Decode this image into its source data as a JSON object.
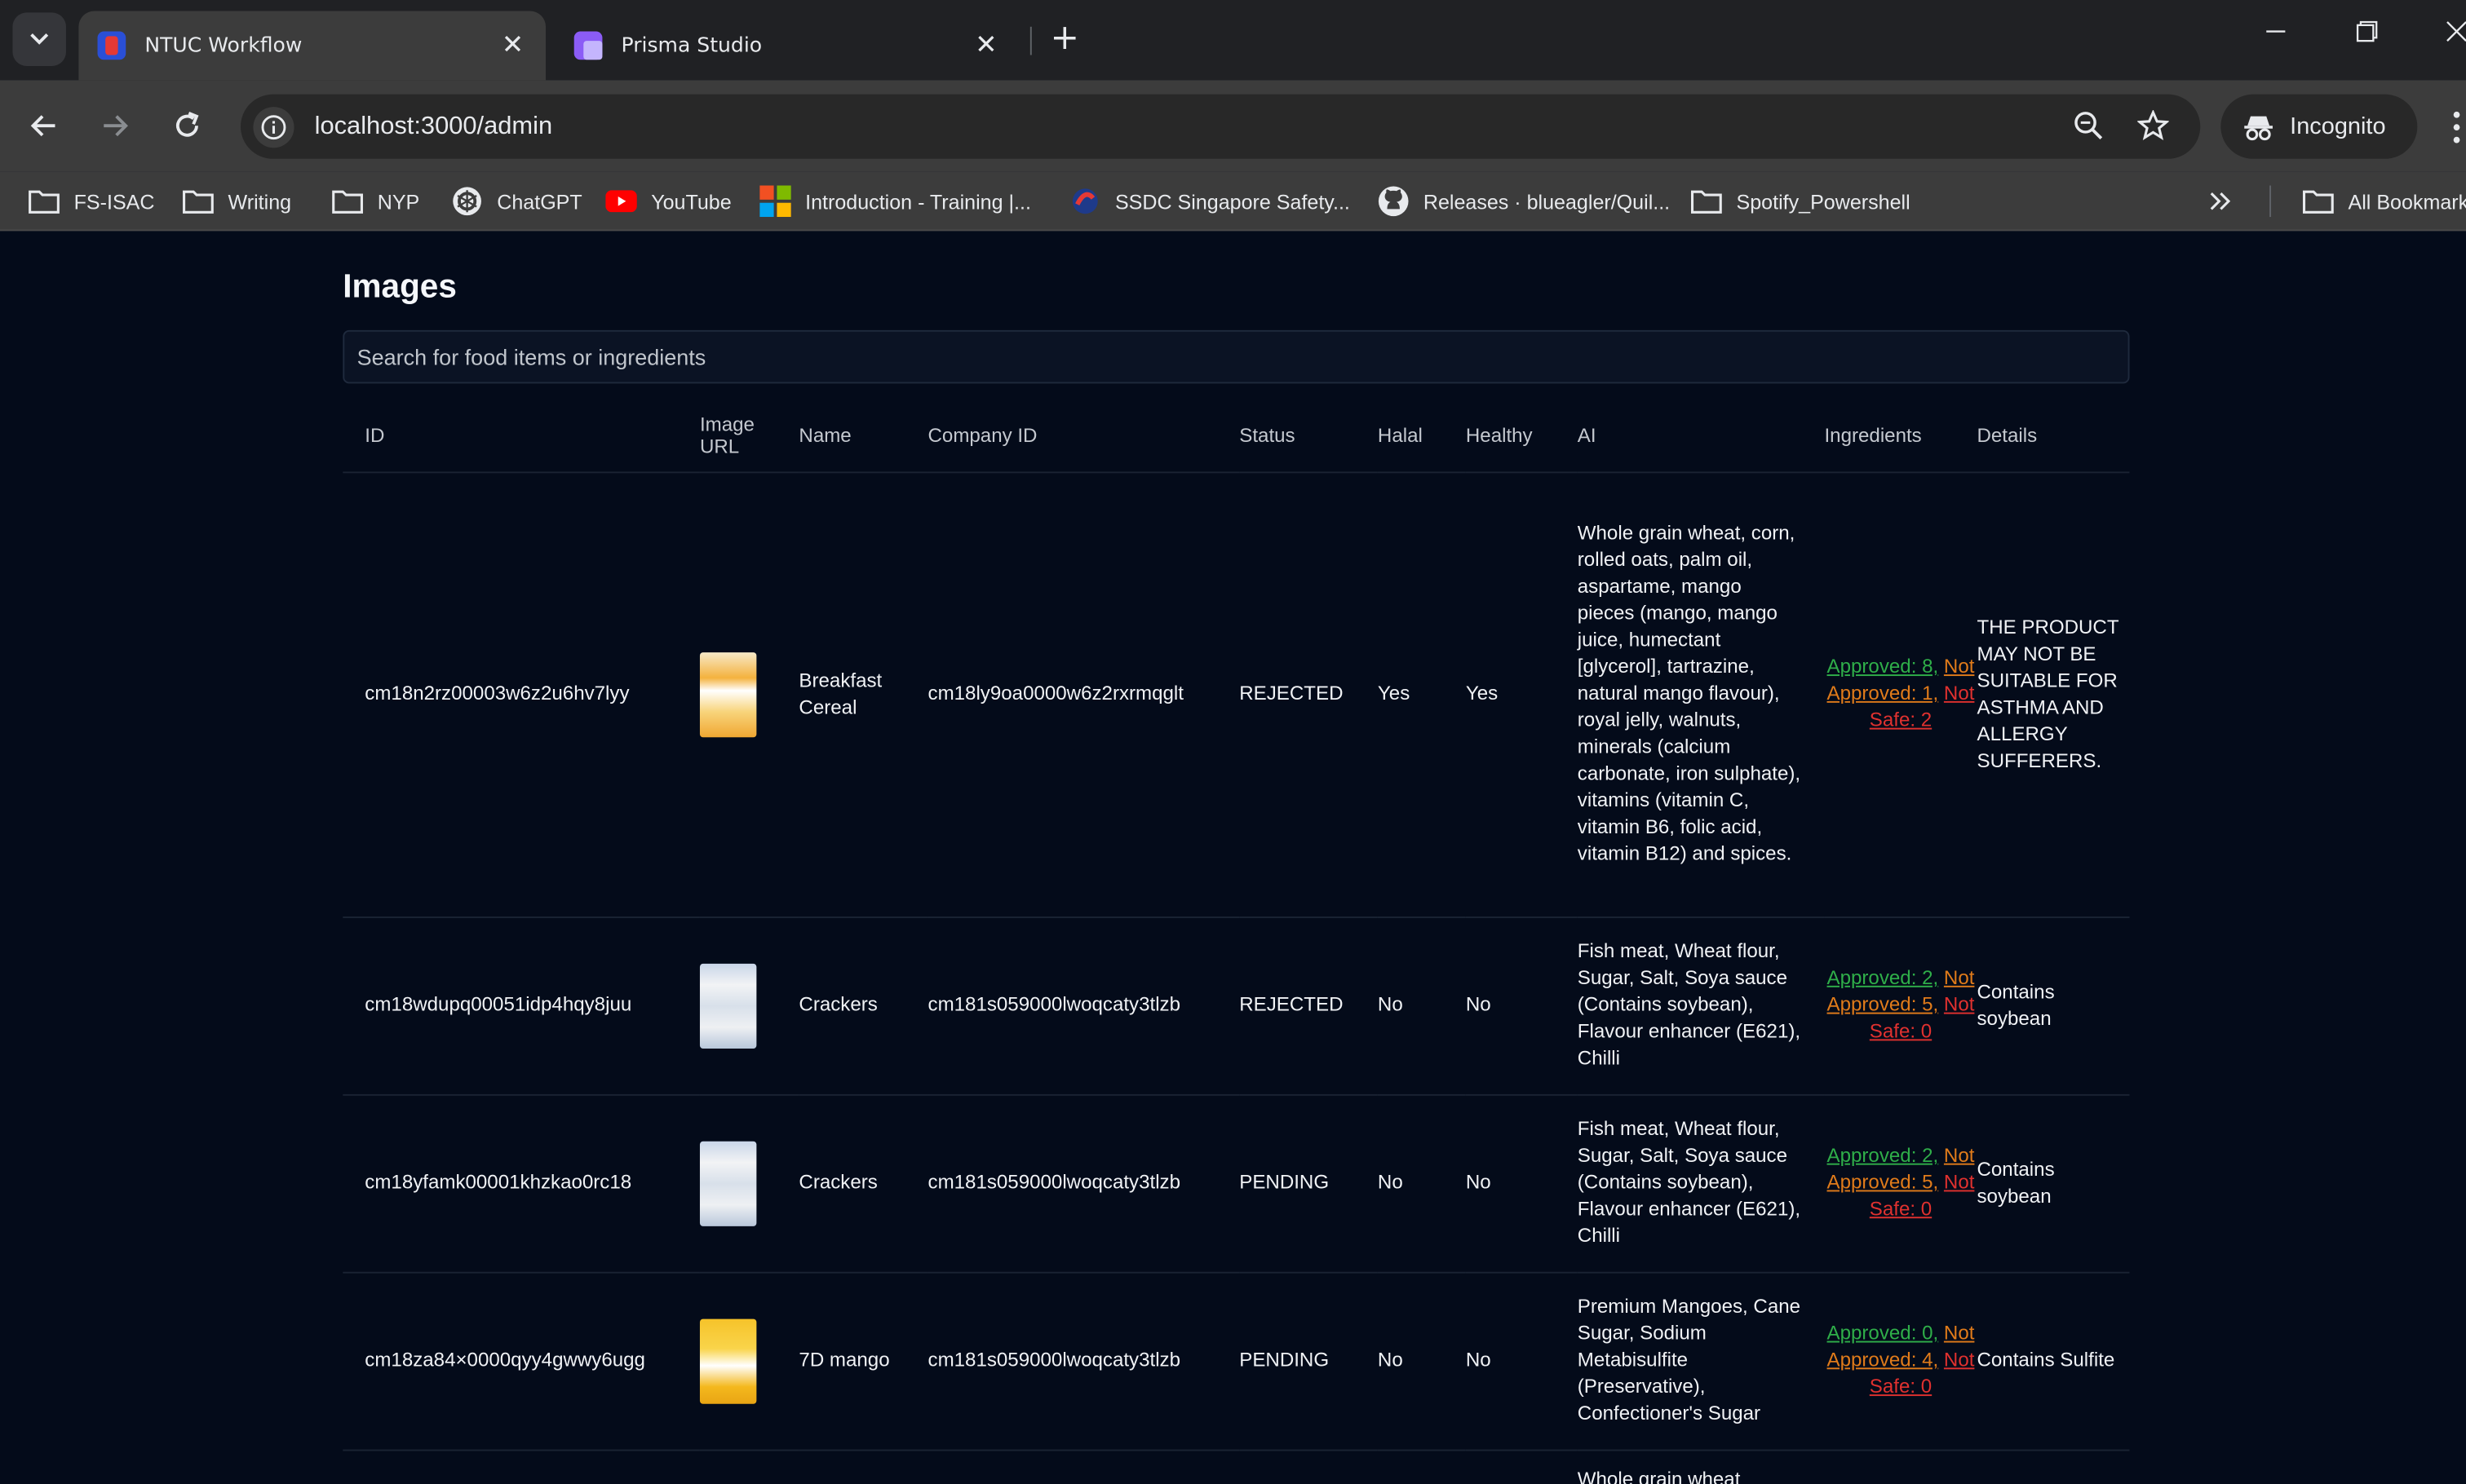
{
  "browser": {
    "tabs": [
      {
        "title": "NTUC Workflow",
        "active": true
      },
      {
        "title": "Prisma Studio",
        "active": false
      }
    ],
    "url": "localhost:3000/admin",
    "incognito_label": "Incognito",
    "bookmarks": [
      {
        "label": "FS-ISAC",
        "icon": "folder-icon"
      },
      {
        "label": "Writing",
        "icon": "folder-icon"
      },
      {
        "label": "NYP",
        "icon": "folder-icon"
      },
      {
        "label": "ChatGPT",
        "icon": "chatgpt-icon"
      },
      {
        "label": "YouTube",
        "icon": "youtube-icon"
      },
      {
        "label": "Introduction - Training |...",
        "icon": "microsoft-icon"
      },
      {
        "label": "SSDC Singapore Safety...",
        "icon": "ssdc-icon"
      },
      {
        "label": "Releases · blueagler/Quil...",
        "icon": "github-icon"
      },
      {
        "label": "Spotify_Powershell",
        "icon": "folder-icon"
      }
    ],
    "all_bookmarks_label": "All Bookmarks"
  },
  "page": {
    "title": "Images",
    "search_placeholder": "Search for food items or ingredients"
  },
  "table": {
    "headers": {
      "id": "ID",
      "image_url": "Image URL",
      "name": "Name",
      "company_id": "Company ID",
      "status": "Status",
      "halal": "Halal",
      "healthy": "Healthy",
      "ai": "AI",
      "ingredients": "Ingredients",
      "details": "Details"
    },
    "rows": [
      {
        "id": "cm18n2rz00003w6z2u6hv7lyy",
        "name": "Breakfast Cereal",
        "company_id": "cm18ly9oa0000w6z2rxrmqglt",
        "status": "REJECTED",
        "halal": "Yes",
        "healthy": "Yes",
        "ai": "Whole grain wheat, corn, rolled oats, palm oil, aspartame, mango pieces (mango, mango juice, humectant [glycerol], tartrazine, natural mango flavour), royal jelly, walnuts, minerals (calcium carbonate, iron sulphate), vitamins (vitamin C, vitamin B6, folic acid, vitamin B12) and spices.",
        "ing_approved": "Approved: 8,",
        "ing_not_approved": "Not Approved: 1,",
        "ing_not_safe": "Not Safe: 2",
        "details": "THE PRODUCT MAY NOT BE SUITABLE FOR ASTHMA AND ALLERGY SUFFERERS.",
        "thumb": "cereal"
      },
      {
        "id": "cm18wdupq00051idp4hqy8juu",
        "name": "Crackers",
        "company_id": "cm181s059000lwoqcaty3tlzb",
        "status": "REJECTED",
        "halal": "No",
        "healthy": "No",
        "ai": "Fish meat, Wheat flour, Sugar, Salt, Soya sauce (Contains soybean), Flavour enhancer (E621), Chilli",
        "ing_approved": "Approved: 2,",
        "ing_not_approved": "Not Approved: 5,",
        "ing_not_safe": "Not Safe: 0",
        "details": "Contains soybean",
        "thumb": "crackers"
      },
      {
        "id": "cm18yfamk00001khzkao0rc18",
        "name": "Crackers",
        "company_id": "cm181s059000lwoqcaty3tlzb",
        "status": "PENDING",
        "halal": "No",
        "healthy": "No",
        "ai": "Fish meat, Wheat flour, Sugar, Salt, Soya sauce (Contains soybean), Flavour enhancer (E621), Chilli",
        "ing_approved": "Approved: 2,",
        "ing_not_approved": "Not Approved: 5,",
        "ing_not_safe": "Not Safe: 0",
        "details": "Contains soybean",
        "thumb": "crackers"
      },
      {
        "id": "cm18za84×0000qyy4gwwy6ugg",
        "name": "7D mango",
        "company_id": "cm181s059000lwoqcaty3tlzb",
        "status": "PENDING",
        "halal": "No",
        "healthy": "No",
        "ai": "Premium Mangoes, Cane Sugar, Sodium Metabisulfite (Preservative), Confectioner's Sugar",
        "ing_approved": "Approved: 0,",
        "ing_not_approved": "Not Approved: 4,",
        "ing_not_safe": "Not Safe: 0",
        "details": "Contains Sulfite",
        "thumb": "mango"
      },
      {
        "id": "",
        "name": "",
        "company_id": "",
        "status": "",
        "halal": "",
        "healthy": "",
        "ai": "Whole grain wheat",
        "ing_approved": "",
        "ing_not_approved": "",
        "ing_not_safe": "",
        "details": "",
        "thumb": "none"
      }
    ]
  },
  "colors": {
    "page_bg": "#040b1a",
    "approved": "#2fae49",
    "not_approved": "#e07b1a",
    "not_safe": "#e0312f"
  }
}
